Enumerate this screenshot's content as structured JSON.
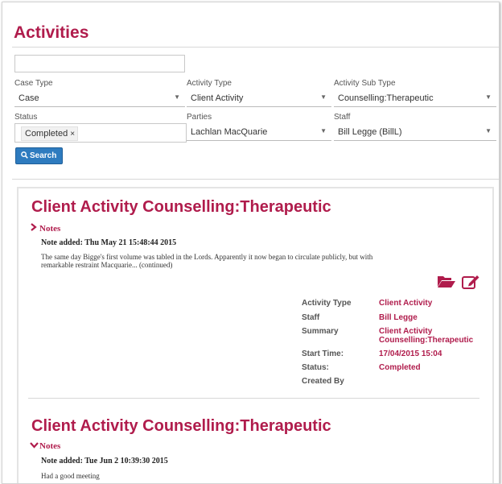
{
  "page": {
    "title": "Activities"
  },
  "filters": {
    "search_value": "",
    "case_type": {
      "label": "Case Type",
      "value": "Case"
    },
    "activity_type": {
      "label": "Activity Type",
      "value": "Client Activity"
    },
    "activity_sub_type": {
      "label": "Activity Sub Type",
      "value": "Counselling:Therapeutic"
    },
    "status": {
      "label": "Status",
      "tag": "Completed",
      "remove": "×"
    },
    "parties": {
      "label": "Parties",
      "value": "Lachlan MacQuarie"
    },
    "staff": {
      "label": "Staff",
      "value": "Bill Legge (BillL)"
    },
    "search_button": "Search"
  },
  "records": [
    {
      "title": "Client Activity Counselling:Therapeutic",
      "notes_label": "Notes",
      "notes_expanded": false,
      "note_added": "Note added: Thu May 21 15:48:44 2015",
      "note_text": "The same day Bigge's first volume was tabled in the Lords. Apparently it now began to circulate publicly, but with remarkable restraint Macquarie... (continued)",
      "icons": [
        "folder-open-icon",
        "edit-icon"
      ],
      "details": {
        "activity_type_label": "Activity Type",
        "activity_type": "Client Activity",
        "staff_label": "Staff",
        "staff": "Bill Legge",
        "summary_label": "Summary",
        "summary": "Client Activity Counselling:Therapeutic",
        "start_time_label": "Start Time:",
        "start_time": "17/04/2015 15:04",
        "status_label": "Status:",
        "status": "Completed",
        "created_by_label": "Created By",
        "created_by": ""
      }
    },
    {
      "title": "Client Activity Counselling:Therapeutic",
      "notes_label": "Notes",
      "notes_expanded": true,
      "note_added": "Note added: Tue Jun 2 10:39:30 2015",
      "note_text": "Had a good meeting"
    }
  ],
  "colors": {
    "accent": "#b01c4c",
    "button": "#2e7bbf"
  }
}
